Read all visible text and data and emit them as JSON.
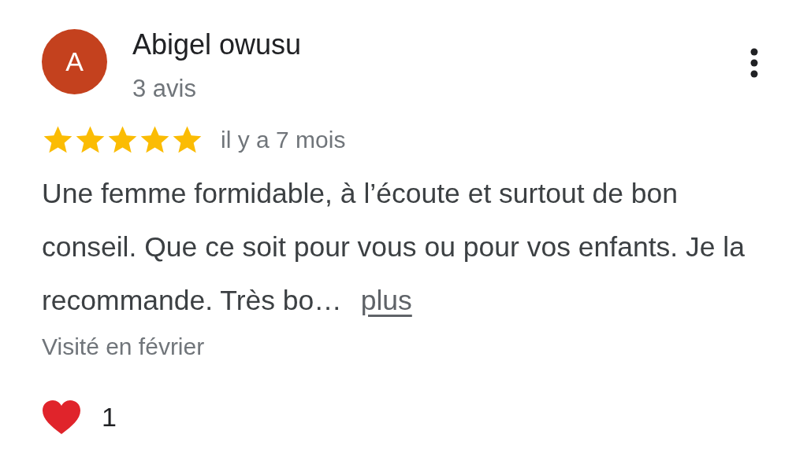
{
  "review": {
    "avatar_letter": "A",
    "author": "Abigel owusu",
    "author_meta": "3 avis",
    "stars": 5,
    "time": "il y a 7 mois",
    "text": "Une femme formidable, à l’écoute et surtout de bon conseil. Que ce soit pour vous ou pour vos enfants. Je la recommande. Très bo…",
    "more_link": "plus",
    "visit": "Visité en février",
    "reaction_count": "1"
  }
}
